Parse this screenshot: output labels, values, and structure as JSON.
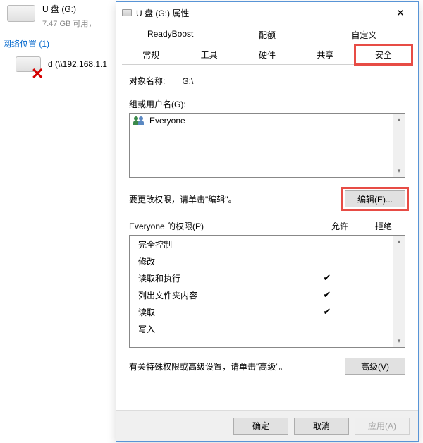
{
  "explorer": {
    "drive_title": "U 盘 (G:)",
    "drive_capacity": "7.47 GB 可用，",
    "section_label": "网络位置 (1)",
    "net_title": "d (\\\\192.168.1.1"
  },
  "dialog": {
    "title": "U 盘 (G:) 属性",
    "tabs_row1": [
      "ReadyBoost",
      "配额",
      "自定义"
    ],
    "tabs_row2": [
      "常规",
      "工具",
      "硬件",
      "共享",
      "安全"
    ],
    "active_tab": "安全",
    "object_name_label": "对象名称:",
    "object_name_value": "G:\\",
    "group_label": "组或用户名(G):",
    "list_items": [
      {
        "name": "Everyone"
      }
    ],
    "edit_hint": "要更改权限，请单击\"编辑\"。",
    "edit_button": "编辑(E)...",
    "perm_title_prefix": "Everyone 的权限(P)",
    "col_allow": "允许",
    "col_deny": "拒绝",
    "permissions": [
      {
        "name": "完全控制",
        "allow": false,
        "deny": false
      },
      {
        "name": "修改",
        "allow": false,
        "deny": false
      },
      {
        "name": "读取和执行",
        "allow": true,
        "deny": false
      },
      {
        "name": "列出文件夹内容",
        "allow": true,
        "deny": false
      },
      {
        "name": "读取",
        "allow": true,
        "deny": false
      },
      {
        "name": "写入",
        "allow": false,
        "deny": false
      }
    ],
    "advanced_hint": "有关特殊权限或高级设置，请单击\"高级\"。",
    "advanced_button": "高级(V)",
    "footer": {
      "ok": "确定",
      "cancel": "取消",
      "apply": "应用(A)"
    }
  }
}
